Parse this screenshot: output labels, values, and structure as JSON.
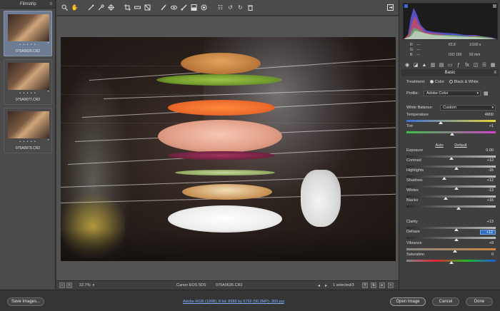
{
  "filmstrip": {
    "title": "Filmstrip",
    "menu_icon": "panel-menu-icon",
    "items": [
      {
        "filename": "075A0626.CR2",
        "rating": "• • • • •",
        "selected": true
      },
      {
        "filename": "075A0677.CR2",
        "rating": "• • • • •",
        "selected": false
      },
      {
        "filename": "075A0679.CR2",
        "rating": "• • • • •",
        "selected": false
      }
    ]
  },
  "toolbar": {
    "tools": [
      "zoom-icon",
      "hand-icon",
      "white-balance-icon",
      "color-sampler-icon",
      "targeted-adjustment-icon",
      "crop-icon",
      "straighten-icon",
      "transform-icon",
      "spot-removal-icon",
      "red-eye-icon",
      "adjustment-brush-icon",
      "graduated-filter-icon",
      "radial-filter-icon",
      "preferences-icon",
      "rotate-left-icon",
      "rotate-right-icon",
      "trash-icon"
    ],
    "fullscreen_icon": "fullscreen-icon"
  },
  "statusbar": {
    "zoom": "22.7%",
    "camera": "Canon EOS 5DS",
    "filename": "075A0626.CR2",
    "selection": "1 selected/3"
  },
  "exif": {
    "r_label": "R:",
    "g_label": "G:",
    "b_label": "B:",
    "r_val": "---",
    "g_val": "---",
    "b_val": "---",
    "aperture": "f/2.8",
    "shutter": "1/160 s",
    "iso": "ISO 100",
    "focal": "50 mm"
  },
  "basic": {
    "title": "Basic",
    "treatment_label": "Treatment:",
    "treatment_color": "Color",
    "treatment_bw": "Black & White",
    "profile_label": "Profile:",
    "profile_value": "Adobe Color",
    "wb_label": "White Balance:",
    "wb_value": "Custom",
    "auto": "Auto",
    "default": "Default",
    "sliders": [
      {
        "name": "Temperature",
        "value": "4900",
        "pos": 0.38
      },
      {
        "name": "Tint",
        "value": "+1",
        "pos": 0.51
      },
      {
        "name": "Exposure",
        "value": "0.00",
        "pos": 0.5
      },
      {
        "name": "Contrast",
        "value": "+12",
        "pos": 0.56
      },
      {
        "name": "Highlights",
        "value": "-16",
        "pos": 0.42
      },
      {
        "name": "Shadows",
        "value": "+12",
        "pos": 0.56
      },
      {
        "name": "Whites",
        "value": "-13",
        "pos": 0.44
      },
      {
        "name": "Blacks",
        "value": "+16",
        "pos": 0.58
      },
      {
        "name": "Clarity",
        "value": "+13",
        "pos": 0.56
      },
      {
        "name": "Dehaze",
        "value": "+12",
        "pos": 0.56,
        "active": true
      },
      {
        "name": "Vibrance",
        "value": "+9",
        "pos": 0.54
      },
      {
        "name": "Saturation",
        "value": "0",
        "pos": 0.5
      }
    ]
  },
  "bottom": {
    "save": "Save Images...",
    "workflow": "Adobe RGB (1998); 8 bit; 8688 by 5792 (50.3MP); 300 ppi",
    "open": "Open Image",
    "cancel": "Cancel",
    "done": "Done"
  }
}
